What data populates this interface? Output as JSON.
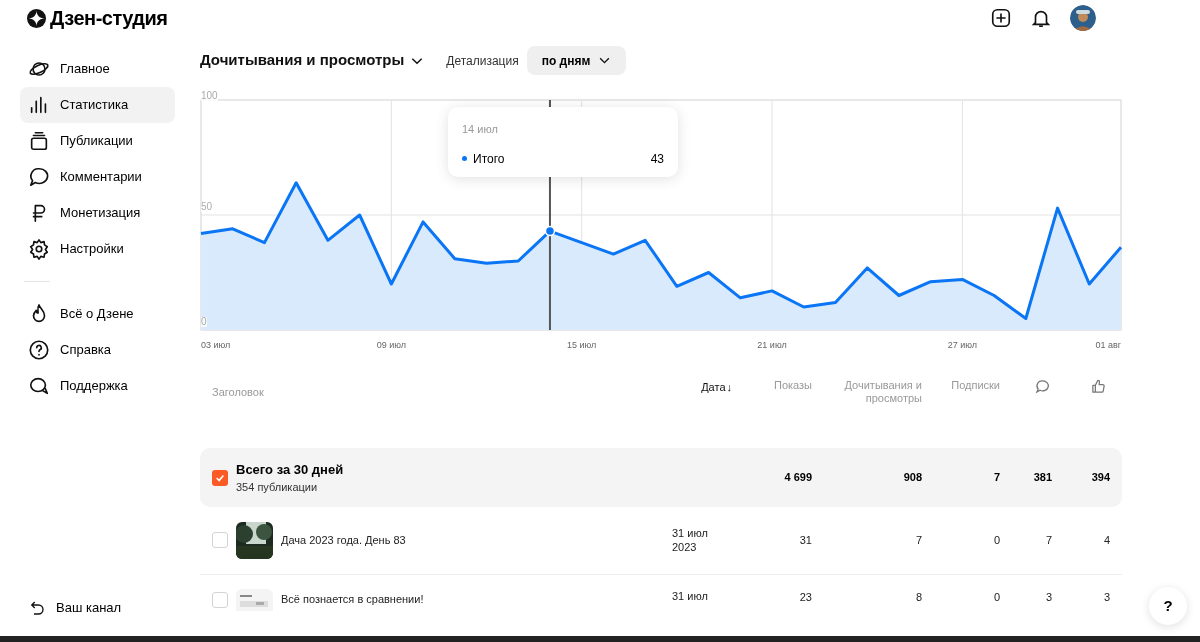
{
  "header": {
    "logo": "Дзен-студия"
  },
  "sidebar": {
    "items": [
      {
        "label": "Главное",
        "selected": false
      },
      {
        "label": "Статистика",
        "selected": true
      },
      {
        "label": "Публикации",
        "selected": false
      },
      {
        "label": "Комментарии",
        "selected": false
      },
      {
        "label": "Монетизация",
        "selected": false
      },
      {
        "label": "Настройки",
        "selected": false
      }
    ],
    "secondary": [
      {
        "label": "Всё о Дзене"
      },
      {
        "label": "Справка"
      },
      {
        "label": "Поддержка"
      }
    ],
    "footer": {
      "label": "Ваш канал"
    }
  },
  "toolbar": {
    "metric": "Дочитывания и просмотры",
    "detail_label": "Детализация",
    "detail_value": "по дням"
  },
  "chart": {
    "tooltip": {
      "date": "14 июл",
      "value": "43"
    },
    "chart_data": {
      "type": "area",
      "grid": true,
      "x": [
        "2023-07-03",
        "2023-07-04",
        "2023-07-05",
        "2023-07-06",
        "2023-07-07",
        "2023-07-08",
        "2023-07-09",
        "2023-07-10",
        "2023-07-11",
        "2023-07-12",
        "2023-07-13",
        "2023-07-14",
        "2023-07-15",
        "2023-07-16",
        "2023-07-17",
        "2023-07-18",
        "2023-07-19",
        "2023-07-20",
        "2023-07-21",
        "2023-07-22",
        "2023-07-23",
        "2023-07-24",
        "2023-07-25",
        "2023-07-26",
        "2023-07-27",
        "2023-07-28",
        "2023-07-29",
        "2023-07-30",
        "2023-07-31",
        "2023-08-01"
      ],
      "series": [
        {
          "name": "Итого",
          "color": "#0a75f5",
          "values": [
            42,
            44,
            38,
            64,
            39,
            50,
            20,
            47,
            31,
            29,
            30,
            43,
            38,
            33,
            39,
            19,
            25,
            14,
            17,
            10,
            12,
            27,
            15,
            21,
            22,
            15,
            5,
            53,
            20,
            36
          ]
        }
      ],
      "ylim": [
        0,
        100
      ],
      "yticks": [
        0,
        50,
        100
      ],
      "xlim": [
        "2023-07-03",
        "2023-08-01"
      ],
      "xticks": [
        {
          "value": "2023-07-03",
          "label": "03 июл"
        },
        {
          "value": "2023-07-09",
          "label": "09 июл"
        },
        {
          "value": "2023-07-15",
          "label": "15 июл"
        },
        {
          "value": "2023-07-21",
          "label": "21 июл"
        },
        {
          "value": "2023-07-27",
          "label": "27 июл"
        },
        {
          "value": "2023-08-01",
          "label": "01 авг"
        }
      ],
      "ref_lines": [
        {
          "axis": "x",
          "value": "2023-07-14"
        }
      ]
    }
  },
  "table": {
    "columns": [
      {
        "label": "Заголовок",
        "kind": "text"
      },
      {
        "label": "Дата",
        "kind": "sorted",
        "sort_mark": "↓"
      },
      {
        "label": "Показы",
        "kind": "text"
      },
      {
        "label": "Дочитывания и просмотры",
        "kind": "text"
      },
      {
        "label": "Подписки",
        "kind": "text"
      },
      {
        "kind": "comment-icon"
      },
      {
        "kind": "like-icon"
      }
    ],
    "summary": {
      "title": "Всего за 30 дней",
      "subtitle": "354 публикации",
      "checked": true,
      "values": [
        "4 699",
        "908",
        "7",
        "381",
        "394"
      ]
    },
    "rows": [
      {
        "title": "Дача 2023 года. День 83",
        "date": "31 июл 2023",
        "checked": false,
        "values": [
          "31",
          "7",
          "0",
          "7",
          "4"
        ]
      },
      {
        "title": "Всё познается в сравнении!",
        "date": "31 июл",
        "checked": false,
        "values": [
          "23",
          "8",
          "0",
          "3",
          "3"
        ]
      }
    ]
  },
  "help_button": "?"
}
